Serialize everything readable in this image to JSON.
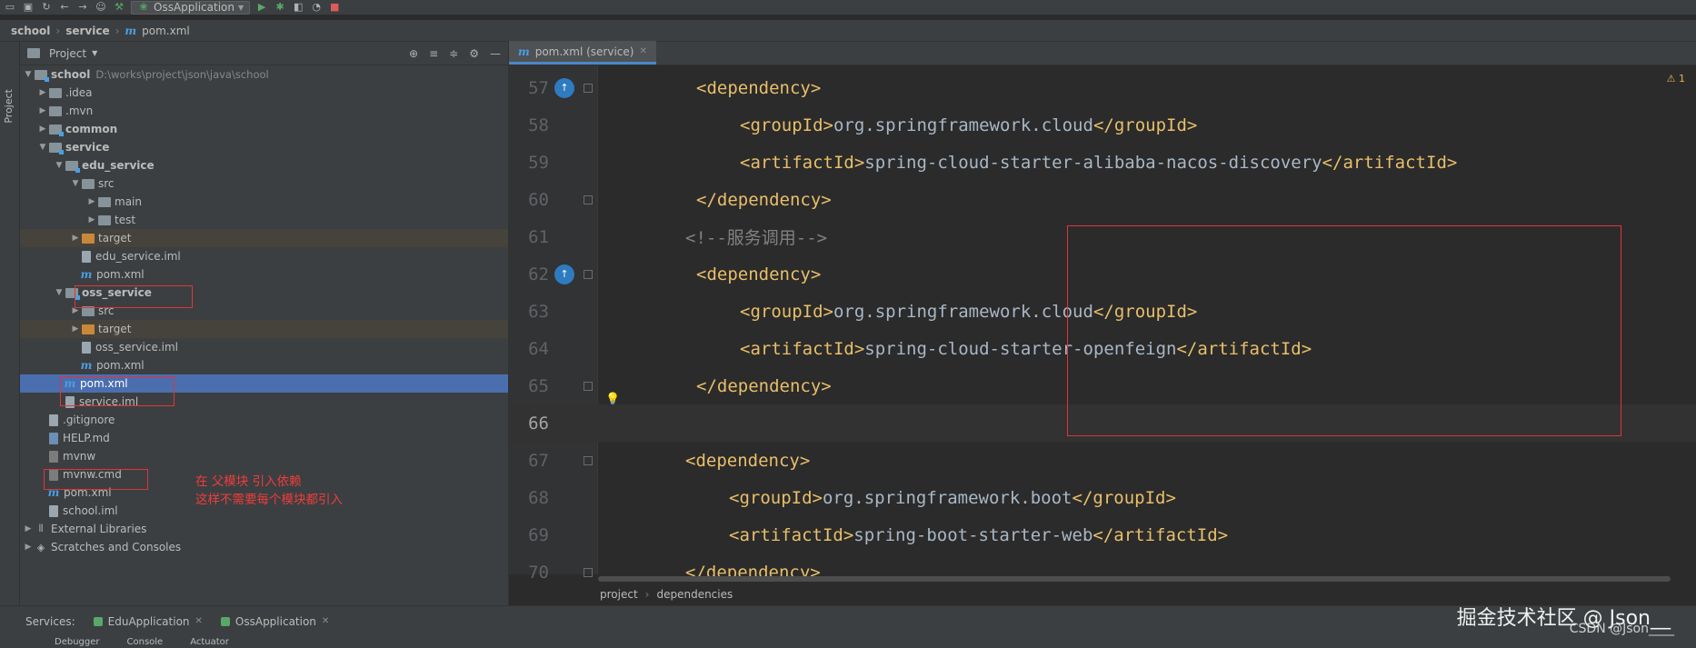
{
  "toolbar": {
    "run_config": "OssApplication"
  },
  "breadcrumb": {
    "items": [
      "school",
      "service"
    ],
    "file": "pom.xml"
  },
  "left_strip": {
    "label": "Project"
  },
  "project_panel": {
    "title": "Project",
    "tree": [
      {
        "label": "school",
        "path": "D:\\works\\project\\json\\java\\school"
      },
      {
        "label": ".idea"
      },
      {
        "label": ".mvn"
      },
      {
        "label": "common"
      },
      {
        "label": "service"
      },
      {
        "label": "edu_service"
      },
      {
        "label": "src"
      },
      {
        "label": "main"
      },
      {
        "label": "test"
      },
      {
        "label": "target"
      },
      {
        "label": "edu_service.iml"
      },
      {
        "label": "pom.xml"
      },
      {
        "label": "oss_service"
      },
      {
        "label": "src"
      },
      {
        "label": "target"
      },
      {
        "label": "oss_service.iml"
      },
      {
        "label": "pom.xml"
      },
      {
        "label": "pom.xml"
      },
      {
        "label": "service.iml"
      },
      {
        "label": ".gitignore"
      },
      {
        "label": "HELP.md"
      },
      {
        "label": "mvnw"
      },
      {
        "label": "mvnw.cmd"
      },
      {
        "label": "pom.xml"
      },
      {
        "label": "school.iml"
      },
      {
        "label": "External Libraries"
      },
      {
        "label": "Scratches and Consoles"
      }
    ],
    "annotation": [
      "在 父模块 引入依赖",
      "这样不需要每个模块都引入"
    ]
  },
  "editor": {
    "tab_label": "pom.xml (service)",
    "warning": "1",
    "lines": [
      {
        "num": "57",
        "parts": [
          [
            "tag",
            "<dependency>"
          ]
        ]
      },
      {
        "num": "58",
        "parts": [
          [
            "tag",
            "<groupId>"
          ],
          [
            "txt",
            "org.springframework.cloud"
          ],
          [
            "tag",
            "</groupId>"
          ]
        ]
      },
      {
        "num": "59",
        "parts": [
          [
            "tag",
            "<artifactId>"
          ],
          [
            "txt",
            "spring-cloud-starter-alibaba-nacos-discovery"
          ],
          [
            "tag",
            "</artifactId>"
          ]
        ]
      },
      {
        "num": "60",
        "parts": [
          [
            "tag",
            "</dependency>"
          ]
        ]
      },
      {
        "num": "61",
        "parts": [
          [
            "cmt",
            "<!--服务调用-->"
          ]
        ]
      },
      {
        "num": "62",
        "parts": [
          [
            "tag",
            "<dependency>"
          ]
        ]
      },
      {
        "num": "63",
        "parts": [
          [
            "tag",
            "<groupId>"
          ],
          [
            "txt",
            "org.springframework.cloud"
          ],
          [
            "tag",
            "</groupId>"
          ]
        ]
      },
      {
        "num": "64",
        "parts": [
          [
            "tag",
            "<artifactId>"
          ],
          [
            "txt",
            "spring-cloud-starter-openfeign"
          ],
          [
            "tag",
            "</artifactId>"
          ]
        ]
      },
      {
        "num": "65",
        "parts": [
          [
            "tag",
            "</dependency>"
          ]
        ]
      },
      {
        "num": "66",
        "parts": []
      },
      {
        "num": "67",
        "parts": [
          [
            "tag",
            "<dependency>"
          ]
        ]
      },
      {
        "num": "68",
        "parts": [
          [
            "tag",
            "<groupId>"
          ],
          [
            "txt",
            "org.springframework.boot"
          ],
          [
            "tag",
            "</groupId>"
          ]
        ]
      },
      {
        "num": "69",
        "parts": [
          [
            "tag",
            "<artifactId>"
          ],
          [
            "txt",
            "spring-boot-starter-web"
          ],
          [
            "tag",
            "</artifactId>"
          ]
        ]
      },
      {
        "num": "70",
        "parts": [
          [
            "tag",
            "</dependency>"
          ]
        ]
      }
    ],
    "crumb": [
      "project",
      "dependencies"
    ]
  },
  "services": {
    "label": "Services:",
    "tabs": [
      "EduApplication",
      "OssApplication"
    ]
  },
  "bottom": [
    "Debugger",
    "Console",
    "Actuator"
  ],
  "watermark": "掘金技术社区 @ Json__",
  "watermark2": "CSDN @Json____",
  "colors": {
    "accent": "#4b6eaf",
    "tag": "#e8bf6a",
    "annotation": "#e0343a"
  }
}
